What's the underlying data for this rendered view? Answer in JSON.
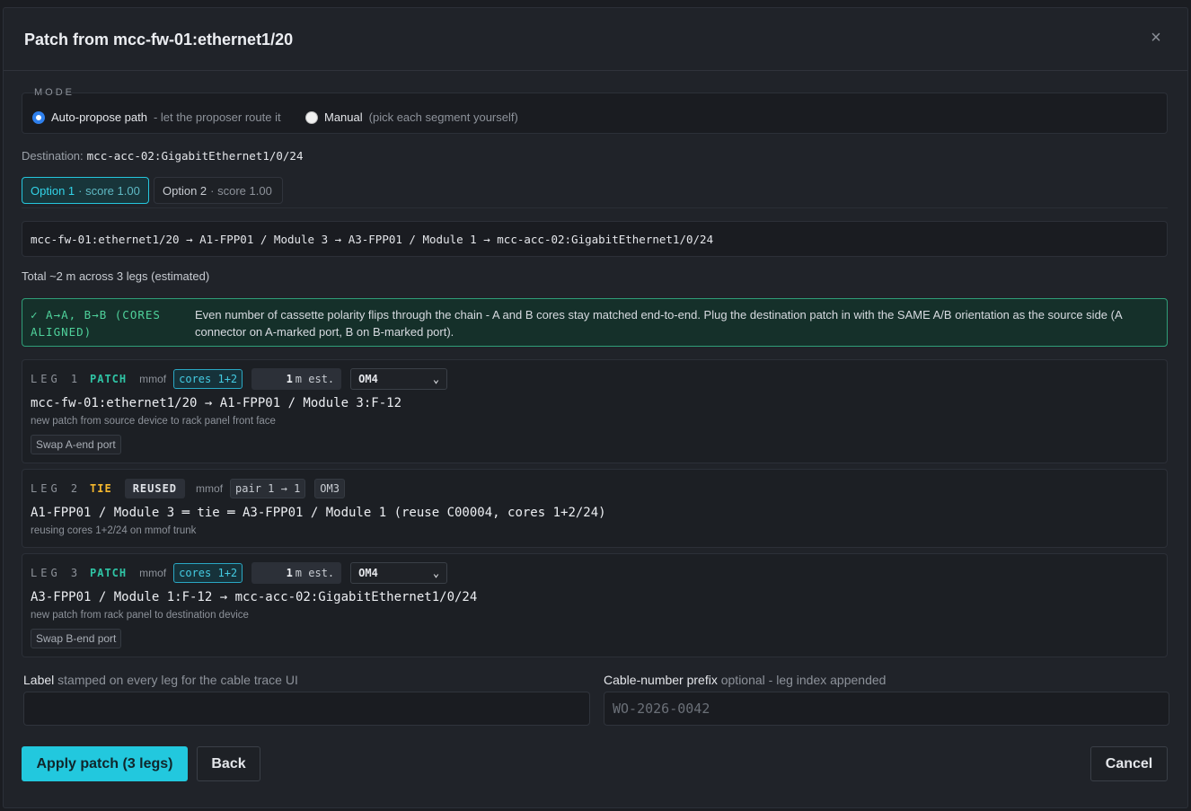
{
  "dialog": {
    "title": "Patch from mcc-fw-01:ethernet1/20",
    "close_glyph": "×"
  },
  "mode": {
    "section_label": "MODE",
    "auto": {
      "label": "Auto-propose path",
      "hint": "- let the proposer route it",
      "selected": true
    },
    "manual": {
      "label": "Manual",
      "hint": "(pick each segment yourself)",
      "selected": false
    }
  },
  "destination": {
    "label": "Destination:",
    "value": "mcc-acc-02:GigabitEthernet1/0/24"
  },
  "options": [
    {
      "label": "Option 1",
      "score": "· score 1.00",
      "active": true
    },
    {
      "label": "Option 2",
      "score": "· score 1.00",
      "active": false
    }
  ],
  "route_path": "mcc-fw-01:ethernet1/20 → A1-FPP01 / Module 3 → A3-FPP01 / Module 1 → mcc-acc-02:GigabitEthernet1/0/24",
  "total": "Total ~2 m across 3 legs (estimated)",
  "polarity": {
    "tag": "✓ A→A, B→B (CORES ALIGNED)",
    "message": "Even number of cassette polarity flips through the chain - A and B cores stay matched end-to-end. Plug the destination patch in with the SAME A/B orientation as the source side (A connector on A-marked port, B on B-marked port)."
  },
  "legs": [
    {
      "id": "LEG 1",
      "type": "PATCH",
      "media": "mmof",
      "cores": "cores 1+2",
      "length_value": "1",
      "length_unit": "m est.",
      "fiber": "OM4",
      "path": "mcc-fw-01:ethernet1/20 → A1-FPP01 / Module 3:F-12",
      "description": "new patch from source device to rack panel front face",
      "swap": "Swap A-end port"
    },
    {
      "id": "LEG 2",
      "type": "TIE",
      "badge": "REUSED",
      "media": "mmof",
      "pair": "pair 1 → 1",
      "fiber": "OM3",
      "path": "A1-FPP01 / Module 3 ═ tie ═ A3-FPP01 / Module 1 (reuse C00004, cores 1+2/24)",
      "description": "reusing cores 1+2/24 on mmof trunk"
    },
    {
      "id": "LEG 3",
      "type": "PATCH",
      "media": "mmof",
      "cores": "cores 1+2",
      "length_value": "1",
      "length_unit": "m est.",
      "fiber": "OM4",
      "path": "A3-FPP01 / Module 1:F-12 → mcc-acc-02:GigabitEthernet1/0/24",
      "description": "new patch from rack panel to destination device",
      "swap": "Swap B-end port"
    }
  ],
  "form": {
    "label_field": {
      "title": "Label",
      "hint": "stamped on every leg for the cable trace UI",
      "value": "",
      "placeholder": ""
    },
    "prefix_field": {
      "title": "Cable-number prefix",
      "hint": "optional - leg index appended",
      "value": "",
      "placeholder": "WO-2026-0042"
    }
  },
  "actions": {
    "apply": "Apply patch (3 legs)",
    "back": "Back",
    "cancel": "Cancel"
  }
}
